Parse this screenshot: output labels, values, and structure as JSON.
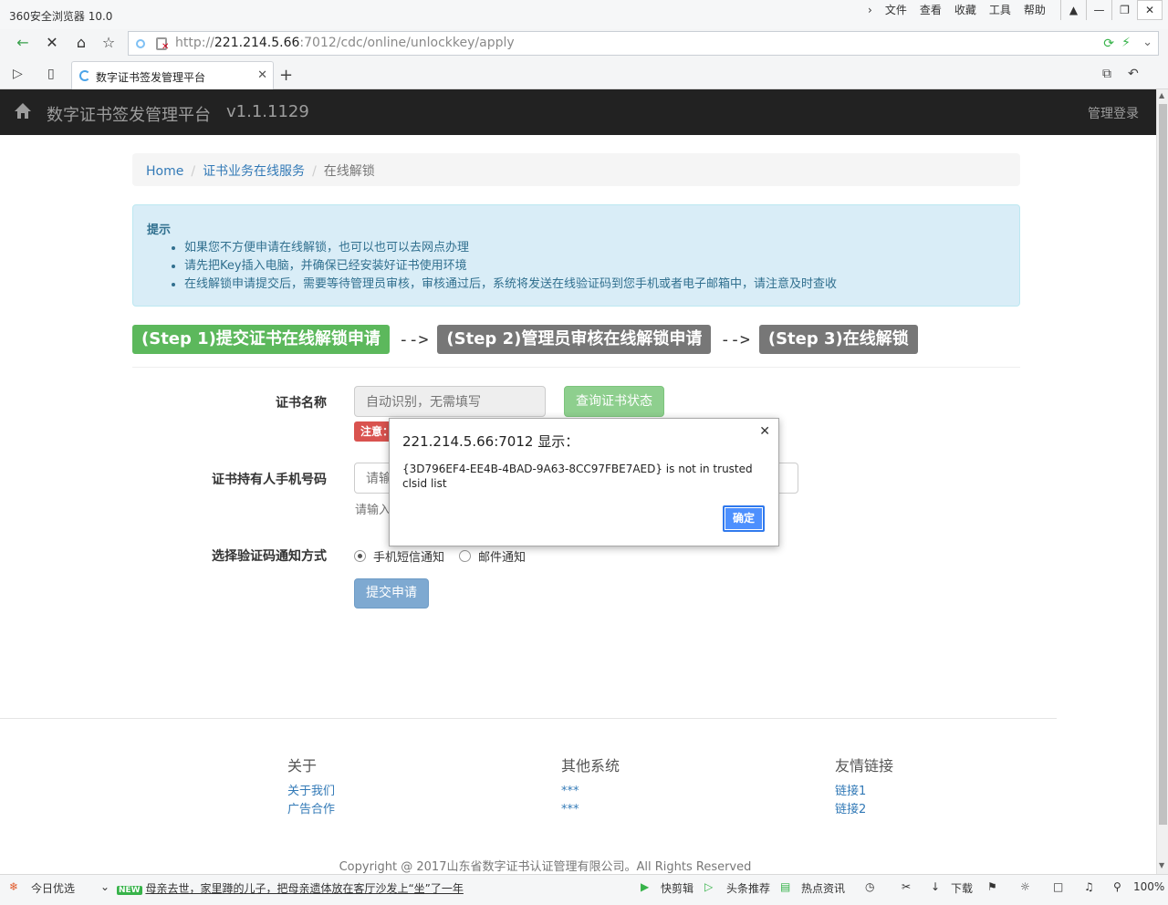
{
  "browser": {
    "title": "360安全浏览器 10.0",
    "menu": [
      "文件",
      "查看",
      "收藏",
      "工具",
      "帮助"
    ],
    "url_prefix": "http://",
    "url_host": "221.214.5.66",
    "url_rest": ":7012/cdc/online/unlockkey/apply",
    "tab_title": "数字证书签发管理平台"
  },
  "navbar": {
    "brand": "数字证书签发管理平台",
    "version": "v1.1.1129",
    "login": "管理登录"
  },
  "breadcrumb": {
    "home": "Home",
    "service": "证书业务在线服务",
    "current": "在线解锁"
  },
  "alert": {
    "title": "提示",
    "items": [
      "如果您不方便申请在线解锁，也可以也可以去网点办理",
      "请先把Key插入电脑，并确保已经安装好证书使用环境",
      "在线解锁申请提交后，需要等待管理员审核，审核通过后，系统将发送在线验证码到您手机或者电子邮箱中，请注意及时查收"
    ]
  },
  "steps": {
    "step1": "(Step 1)提交证书在线解锁申请",
    "arrow": "-->",
    "step2": "(Step 2)管理员审核在线解锁申请",
    "step3": "(Step 3)在线解锁"
  },
  "form": {
    "cert_name_label": "证书名称",
    "cert_name_placeholder": "自动识别，无需填写",
    "query_button": "查询证书状态",
    "warning_badge": "注意：",
    "phone_label": "证书持有人手机号码",
    "phone_placeholder": "请输",
    "phone_help": "请输入",
    "notify_label": "选择验证码通知方式",
    "notify_sms": "手机短信通知",
    "notify_email": "邮件通知",
    "submit_button": "提交申请"
  },
  "footer": {
    "about_title": "关于",
    "about_links": [
      "关于我们",
      "广告合作"
    ],
    "systems_title": "其他系统",
    "systems_links": [
      "***",
      "***"
    ],
    "links_title": "友情链接",
    "links": [
      "链接1",
      "链接2"
    ],
    "copyright": "Copyright @ 2017山东省数字证书认证管理有限公司。All Rights Reserved"
  },
  "dialog": {
    "title": "221.214.5.66:7012 显示：",
    "message": "{3D796EF4-EE4B-4BAD-9A63-8CC97FBE7AED} is not in trusted clsid list",
    "ok": "确定"
  },
  "statusbar": {
    "today": "今日优选",
    "news_badge": "NEW",
    "news": "母亲去世，家里蹲的儿子，把母亲遗体放在客厅沙发上“坐”了一年",
    "clip": "快剪辑",
    "headline": "头条推荐",
    "hot": "热点资讯",
    "download": "下载",
    "zoom": "100%"
  },
  "colors": {
    "navbar_bg": "#222222",
    "step_active": "#5cb85c",
    "step_inactive": "#777777",
    "alert_bg": "#d9edf7",
    "link": "#337ab7"
  }
}
